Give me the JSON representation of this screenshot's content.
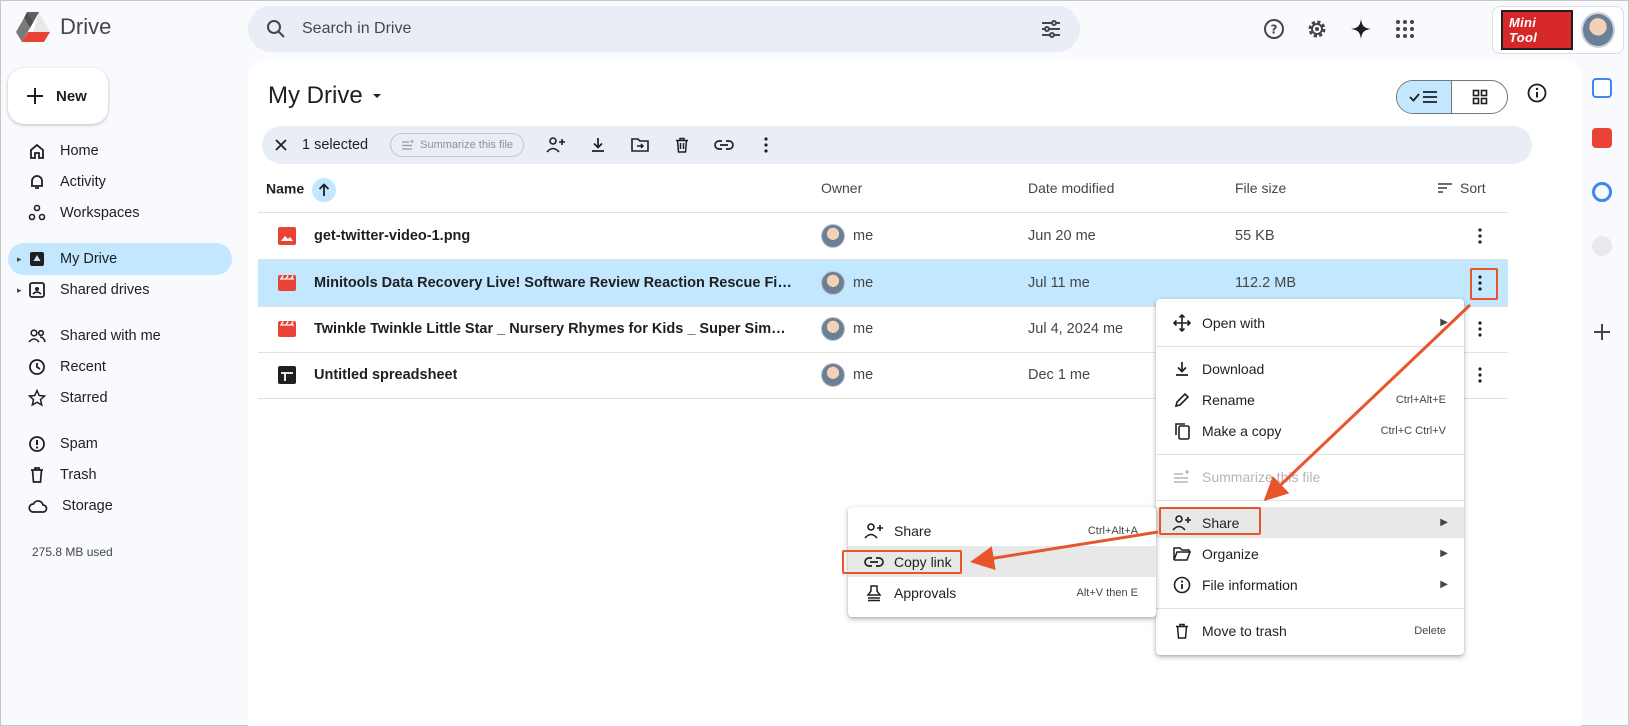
{
  "app": {
    "name": "Drive",
    "brand": "Mini Tool"
  },
  "search": {
    "placeholder": "Search in Drive"
  },
  "sidebar": {
    "new_label": "New",
    "items": [
      {
        "label": "Home"
      },
      {
        "label": "Activity"
      },
      {
        "label": "Workspaces"
      },
      {
        "label": "My Drive"
      },
      {
        "label": "Shared drives"
      },
      {
        "label": "Shared with me"
      },
      {
        "label": "Recent"
      },
      {
        "label": "Starred"
      },
      {
        "label": "Spam"
      },
      {
        "label": "Trash"
      },
      {
        "label": "Storage"
      }
    ],
    "storage_used": "275.8 MB used"
  },
  "main": {
    "title": "My Drive",
    "selection": {
      "count": "1 selected",
      "summarize": "Summarize this file"
    },
    "columns": {
      "name": "Name",
      "owner": "Owner",
      "date": "Date modified",
      "size": "File size",
      "sort": "Sort"
    },
    "files": [
      {
        "name": "get-twitter-video-1.png",
        "owner": "me",
        "date": "Jun 20 me",
        "size": "55 KB",
        "type": "image"
      },
      {
        "name": "Minitools Data Recovery Live! Software Review Reaction Rescue Files Har...",
        "owner": "me",
        "date": "Jul 11 me",
        "size": "112.2 MB",
        "type": "video"
      },
      {
        "name": "Twinkle Twinkle Little Star _ Nursery Rhymes for Kids _ Super Simple Song...",
        "owner": "me",
        "date": "Jul 4, 2024 me",
        "size": "",
        "type": "video"
      },
      {
        "name": "Untitled spreadsheet",
        "owner": "me",
        "date": "Dec 1 me",
        "size": "",
        "type": "sheet"
      }
    ]
  },
  "context_menu": {
    "open_with": "Open with",
    "download": "Download",
    "rename": "Rename",
    "rename_shortcut": "Ctrl+Alt+E",
    "make_copy": "Make a copy",
    "make_copy_shortcut": "Ctrl+C Ctrl+V",
    "summarize": "Summarize this file",
    "share": "Share",
    "organize": "Organize",
    "file_info": "File information",
    "move_trash": "Move to trash",
    "move_trash_shortcut": "Delete"
  },
  "share_submenu": {
    "share": "Share",
    "share_shortcut": "Ctrl+Alt+A",
    "copy_link": "Copy link",
    "approvals": "Approvals",
    "approvals_shortcut": "Alt+V then E"
  },
  "colors": {
    "accent": "#c2e7ff",
    "highlight": "#e8552b",
    "video": "#ea4335"
  }
}
